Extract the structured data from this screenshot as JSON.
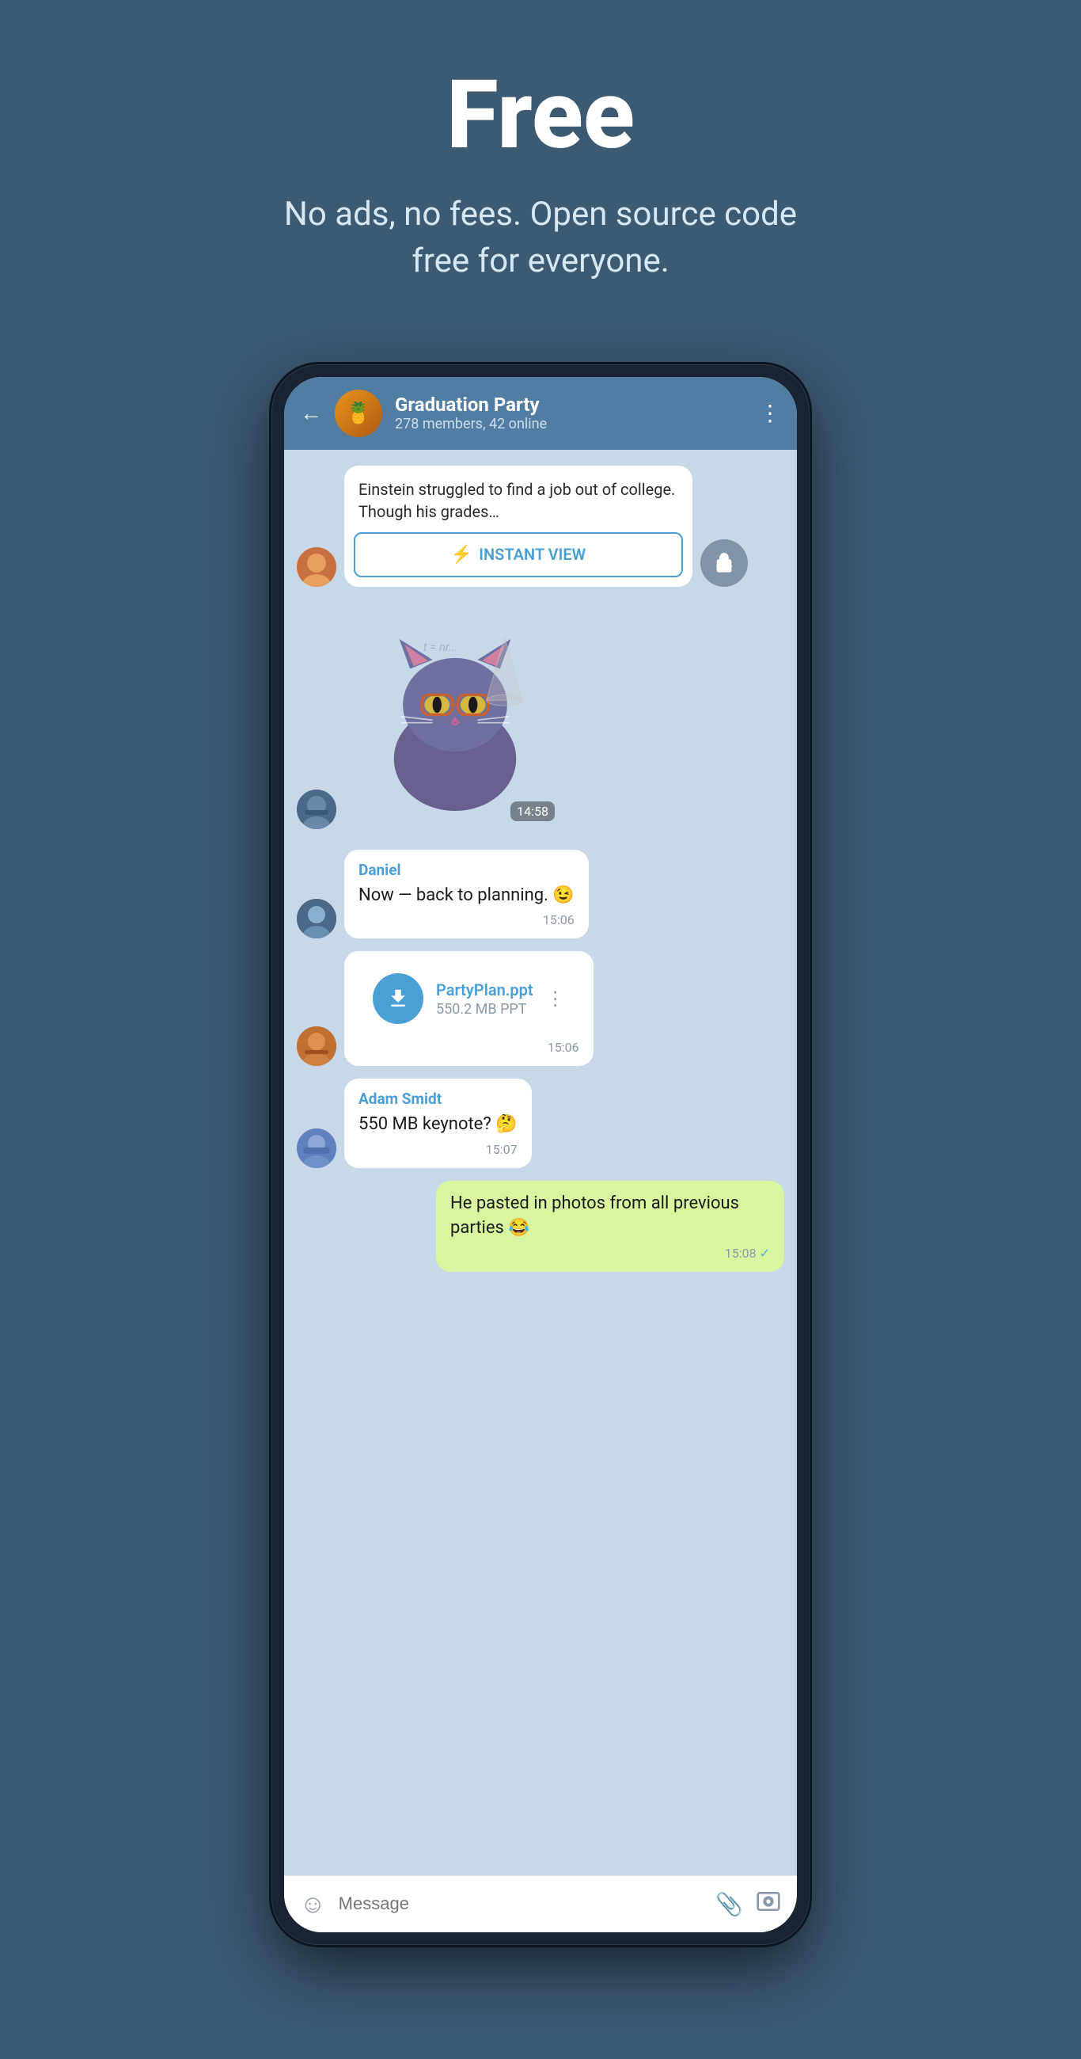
{
  "hero": {
    "title": "Free",
    "subtitle": "No ads, no fees. Open source code free for everyone."
  },
  "chat": {
    "back_label": "←",
    "group_name": "Graduation Party",
    "group_status": "278 members, 42 online",
    "menu_icon": "⋮",
    "article_text": "Einstein struggled to find a job out of college. Though his grades…",
    "instant_view_label": "INSTANT VIEW",
    "sticker_time": "14:58",
    "messages": [
      {
        "sender": "Daniel",
        "text": "Now — back to planning. 😉",
        "time": "15:06",
        "type": "text",
        "side": "left"
      },
      {
        "sender": "",
        "file_name": "PartyPlan.ppt",
        "file_size": "550.2 MB PPT",
        "time": "15:06",
        "type": "file",
        "side": "left"
      },
      {
        "sender": "Adam Smidt",
        "text": "550 MB keynote? 🤔",
        "time": "15:07",
        "type": "text",
        "side": "left"
      },
      {
        "sender": "",
        "text": "He pasted in photos from all previous parties 😂",
        "time": "15:08",
        "type": "text",
        "side": "right"
      }
    ],
    "input_placeholder": "Message"
  },
  "icons": {
    "back": "←",
    "menu": "⋮",
    "share": "↗",
    "bolt": "⚡",
    "emoji": "☺",
    "attach": "📎",
    "camera": "⊙",
    "download": "↓",
    "checkmark": "✓"
  }
}
